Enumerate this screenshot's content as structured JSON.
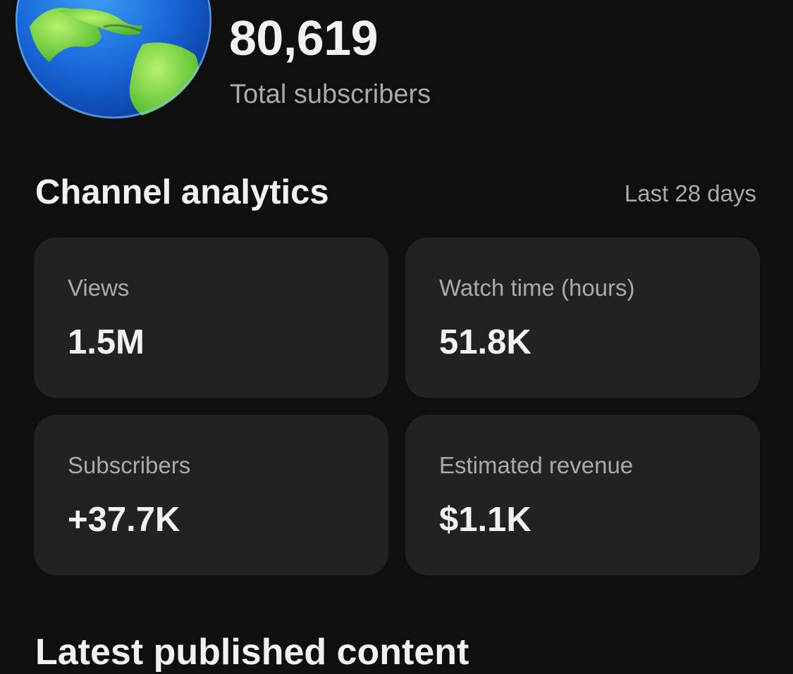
{
  "channel": {
    "avatar_icon": "globe-americas-icon",
    "total_subscribers": "80,619",
    "total_subscribers_label": "Total subscribers"
  },
  "analytics": {
    "title": "Channel analytics",
    "period": "Last 28 days",
    "cards": [
      {
        "label": "Views",
        "value": "1.5M"
      },
      {
        "label": "Watch time (hours)",
        "value": "51.8K"
      },
      {
        "label": "Subscribers",
        "value": "+37.7K"
      },
      {
        "label": "Estimated revenue",
        "value": "$1.1K"
      }
    ]
  },
  "latest": {
    "title": "Latest published content"
  },
  "colors": {
    "background": "#0f0f0f",
    "card": "#222222",
    "primary_text": "#f1f1f1",
    "secondary_text": "#aaaaaa"
  }
}
